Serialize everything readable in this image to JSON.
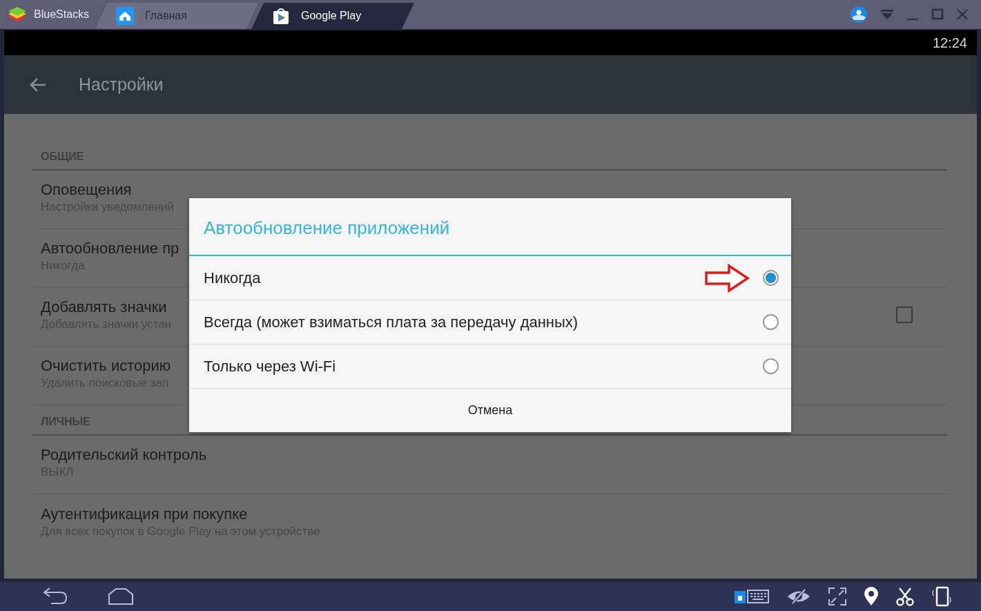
{
  "window": {
    "app_name": "BlueStacks",
    "tabs": [
      {
        "label": "Главная",
        "selected": false
      },
      {
        "label": "Google Play",
        "selected": true
      }
    ]
  },
  "status_bar": {
    "time": "12:24"
  },
  "action_bar": {
    "title": "Настройки"
  },
  "sections": [
    {
      "header": "ОБЩИЕ",
      "items": [
        {
          "kind": "text",
          "title": "Оповещения",
          "summary": "Настройки уведомлений"
        },
        {
          "kind": "text",
          "title": "Автообновление пр",
          "summary": "Никогда"
        },
        {
          "kind": "checkbox",
          "title": "Добавлять значки",
          "summary": "Добавлять значки устан",
          "checked": false
        },
        {
          "kind": "text",
          "title": "Очистить историю",
          "summary": "Удалить поисковые зап"
        }
      ]
    },
    {
      "header": "ЛИЧНЫЕ",
      "items": [
        {
          "kind": "text",
          "title": "Родительский контроль",
          "summary": "ВЫКЛ"
        },
        {
          "kind": "text",
          "title": "Аутентификация при покупке",
          "summary": "Для всех покупок в Google Play на этом устройстве"
        }
      ]
    }
  ],
  "dialog": {
    "title": "Автообновление приложений",
    "options": [
      {
        "label": "Никогда",
        "selected": true
      },
      {
        "label": "Всегда (может взиматься плата за передачу данных)",
        "selected": false
      },
      {
        "label": "Только через Wi-Fi",
        "selected": false
      }
    ],
    "cancel": "Отмена"
  }
}
